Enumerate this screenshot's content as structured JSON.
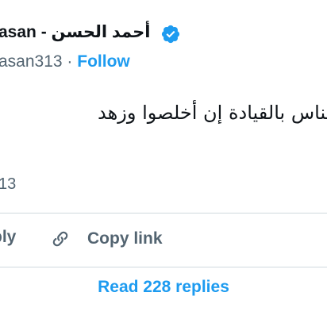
{
  "author": {
    "display_name_ar": "أحمد الحسن",
    "separator": " - ",
    "display_name_en_partial": "asan",
    "handle_partial": "asan313",
    "dot": " · ",
    "follow_label": "Follow"
  },
  "tweet": {
    "text_partial": "لناس بالقيادة إن أخلصوا وزهد",
    "time_partial": "13"
  },
  "actions": {
    "reply_partial": "ply",
    "copy_link_label": "Copy link",
    "read_replies_label": "Read 228 replies"
  },
  "colors": {
    "accent": "#1d9bf0",
    "secondary_text": "#536471",
    "divider": "#cfd9de"
  },
  "icons": {
    "verified": "verified-badge-icon",
    "copy_link": "link-icon"
  }
}
